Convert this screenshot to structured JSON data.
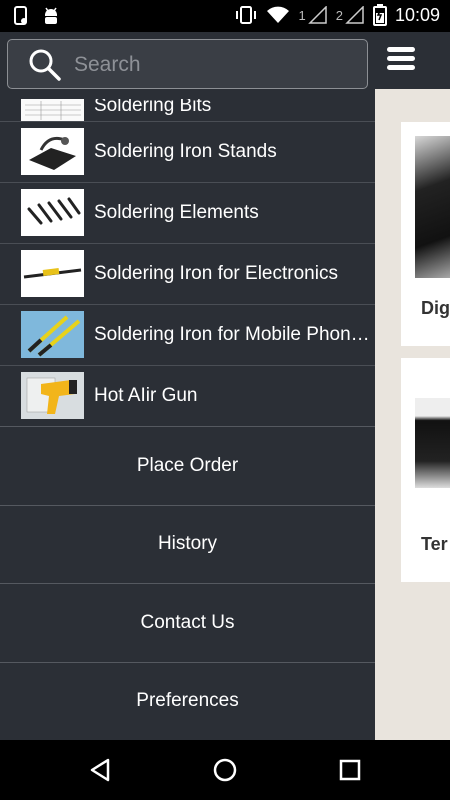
{
  "status_bar": {
    "time": "10:09",
    "sim1": "1",
    "sim2": "2"
  },
  "search": {
    "placeholder": "Search",
    "value": ""
  },
  "categories": [
    {
      "label": "Soldering Bits",
      "icon": "soldering-bits-thumbnail"
    },
    {
      "label": "Soldering Iron Stands",
      "icon": "iron-stand-thumbnail"
    },
    {
      "label": "Soldering Elements",
      "icon": "elements-thumbnail"
    },
    {
      "label": "Soldering Iron for Electronics",
      "icon": "electronics-iron-thumbnail"
    },
    {
      "label": "Soldering Iron for Mobile Phones",
      "icon": "mobile-iron-thumbnail"
    },
    {
      "label": "Hot AIir Gun",
      "icon": "hot-air-gun-thumbnail"
    }
  ],
  "menu": {
    "place_order": "Place Order",
    "history": "History",
    "contact_us": "Contact Us",
    "preferences": "Preferences"
  },
  "main": {
    "cards": [
      {
        "title": "Dig"
      },
      {
        "title": "Ter"
      }
    ]
  },
  "colors": {
    "drawer_bg": "#2b2f36",
    "content_bg": "#e9e4dd",
    "text": "#ffffff"
  }
}
